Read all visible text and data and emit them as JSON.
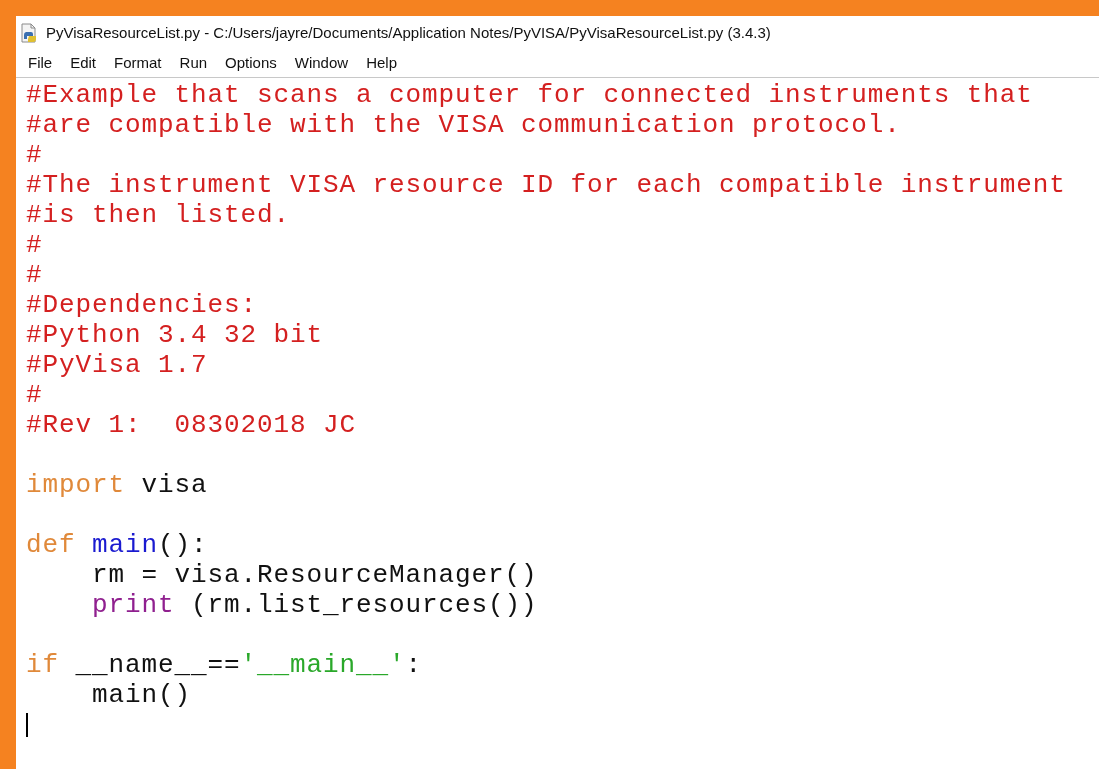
{
  "window": {
    "title": "PyVisaResourceList.py - C:/Users/jayre/Documents/Application Notes/PyVISA/PyVisaResourceList.py (3.4.3)"
  },
  "menu": [
    "File",
    "Edit",
    "Format",
    "Run",
    "Options",
    "Window",
    "Help"
  ],
  "editor": {
    "lines": [
      {
        "kind": "code",
        "tokens": [
          {
            "kind": "comment",
            "text": "#Example that scans a computer for connected instruments that"
          }
        ]
      },
      {
        "kind": "code",
        "tokens": [
          {
            "kind": "comment",
            "text": "#are compatible with the VISA communication protocol."
          }
        ]
      },
      {
        "kind": "code",
        "tokens": [
          {
            "kind": "comment",
            "text": "#"
          }
        ]
      },
      {
        "kind": "code",
        "tokens": [
          {
            "kind": "comment",
            "text": "#The instrument VISA resource ID for each compatible instrument"
          }
        ]
      },
      {
        "kind": "code",
        "tokens": [
          {
            "kind": "comment",
            "text": "#is then listed."
          }
        ]
      },
      {
        "kind": "code",
        "tokens": [
          {
            "kind": "comment",
            "text": "#"
          }
        ]
      },
      {
        "kind": "code",
        "tokens": [
          {
            "kind": "comment",
            "text": "#"
          }
        ]
      },
      {
        "kind": "code",
        "tokens": [
          {
            "kind": "comment",
            "text": "#Dependencies:"
          }
        ]
      },
      {
        "kind": "code",
        "tokens": [
          {
            "kind": "comment",
            "text": "#Python 3.4 32 bit"
          }
        ]
      },
      {
        "kind": "code",
        "tokens": [
          {
            "kind": "comment",
            "text": "#PyVisa 1.7"
          }
        ]
      },
      {
        "kind": "code",
        "tokens": [
          {
            "kind": "comment",
            "text": "#"
          }
        ]
      },
      {
        "kind": "code",
        "tokens": [
          {
            "kind": "comment",
            "text": "#Rev 1:  08302018 JC"
          }
        ]
      },
      {
        "kind": "blank"
      },
      {
        "kind": "code",
        "tokens": [
          {
            "kind": "keyword",
            "text": "import"
          },
          {
            "kind": "plain",
            "text": " visa"
          }
        ]
      },
      {
        "kind": "blank"
      },
      {
        "kind": "code",
        "tokens": [
          {
            "kind": "keyword",
            "text": "def"
          },
          {
            "kind": "definition",
            "text": " main"
          },
          {
            "kind": "plain",
            "text": "():"
          }
        ]
      },
      {
        "kind": "code",
        "tokens": [
          {
            "kind": "plain",
            "text": "    rm = visa.ResourceManager()"
          }
        ]
      },
      {
        "kind": "code",
        "tokens": [
          {
            "kind": "builtin",
            "text": "    print"
          },
          {
            "kind": "plain",
            "text": " (rm.list_resources())"
          }
        ]
      },
      {
        "kind": "blank"
      },
      {
        "kind": "code",
        "tokens": [
          {
            "kind": "keyword",
            "text": "if"
          },
          {
            "kind": "plain",
            "text": " __name__=="
          },
          {
            "kind": "string",
            "text": "'__main__'"
          },
          {
            "kind": "plain",
            "text": ":"
          }
        ]
      },
      {
        "kind": "code",
        "tokens": [
          {
            "kind": "plain",
            "text": "    main()"
          }
        ]
      },
      {
        "kind": "cursor"
      }
    ]
  }
}
